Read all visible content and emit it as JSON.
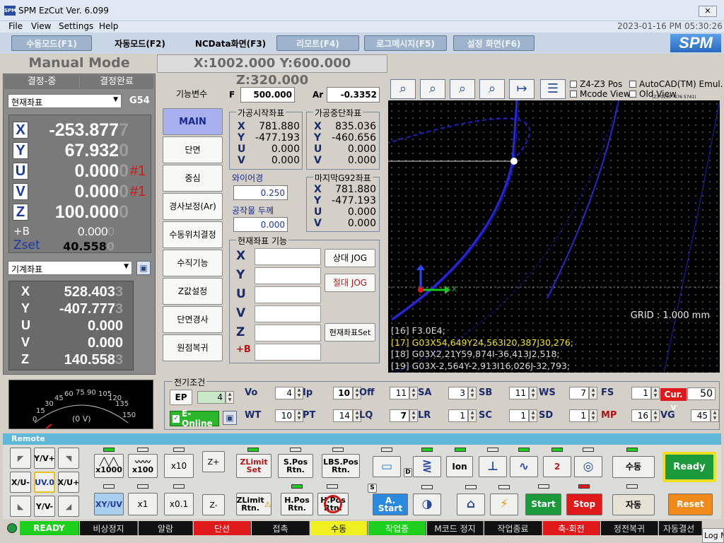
{
  "window": {
    "title": "SPM EzCut Ver. 6.099",
    "app_icon": "SPM",
    "timestamp": "2023-01-16 PM 05:30:26"
  },
  "menu": [
    "File",
    "View",
    "Settings",
    "Help"
  ],
  "tabs": [
    "수동모드(F1)",
    "자동모드(F2)",
    "NCData화면(F3)",
    "리모트(F4)",
    "로그메시지(F5)",
    "설정 화면(F6)"
  ],
  "logo": "SPM",
  "mode_title": "Manual Mode",
  "xyz_readout": "X:1002.000 Y:600.000 Z:320.000",
  "measure": {
    "left": "결정-중",
    "right": "결정완료"
  },
  "coord_select": {
    "value": "현재좌표",
    "work_offset": "G54"
  },
  "current_coords": [
    {
      "axis": "X",
      "value": "-253.877",
      "ghost": "7",
      "suffix": ""
    },
    {
      "axis": "Y",
      "value": "67.932",
      "ghost": "0",
      "suffix": ""
    },
    {
      "axis": "U",
      "value": "0.000",
      "ghost": "0",
      "suffix": "#1"
    },
    {
      "axis": "V",
      "value": "0.000",
      "ghost": "0",
      "suffix": "#1"
    },
    {
      "axis": "Z",
      "value": "100.000",
      "ghost": "0",
      "suffix": ""
    }
  ],
  "plus_b": {
    "label": "+B",
    "value": "0.000",
    "ghost": "0"
  },
  "zset": {
    "label": "Zset",
    "value": "40.558",
    "ghost": "0"
  },
  "machine_select": {
    "value": "기계좌표"
  },
  "machine_coords": [
    {
      "axis": "X",
      "value": "528.403",
      "ghost": "3"
    },
    {
      "axis": "Y",
      "value": "-407.777",
      "ghost": "3"
    },
    {
      "axis": "U",
      "value": "0.000",
      "ghost": ""
    },
    {
      "axis": "V",
      "value": "0.000",
      "ghost": ""
    },
    {
      "axis": "Z",
      "value": "140.558",
      "ghost": "3"
    }
  ],
  "func_label": "기능변수",
  "func_buttons": [
    "MAIN",
    "단면",
    "중심",
    "경사보정(Ar)",
    "수동위치결정",
    "수직기능",
    "Z값설정",
    "단면경사",
    "원점복귀"
  ],
  "f_label": "F",
  "f_value": "500.000",
  "ar_label": "Ar",
  "ar_value": "-0.3352",
  "start_group": {
    "title": "가공시작좌표",
    "rows": [
      {
        "k": "X",
        "v": "781.880"
      },
      {
        "k": "Y",
        "v": "-477.193"
      },
      {
        "k": "U",
        "v": "0.000"
      },
      {
        "k": "V",
        "v": "0.000"
      }
    ]
  },
  "end_group": {
    "title": "가공중단좌표",
    "rows": [
      {
        "k": "X",
        "v": "835.036"
      },
      {
        "k": "Y",
        "v": "-460.656"
      },
      {
        "k": "U",
        "v": "0.000"
      },
      {
        "k": "V",
        "v": "0.000"
      }
    ]
  },
  "g92_group": {
    "title": "마지막G92좌표",
    "rows": [
      {
        "k": "X",
        "v": "781.880"
      },
      {
        "k": "Y",
        "v": "-477.193"
      },
      {
        "k": "U",
        "v": "0.000"
      },
      {
        "k": "V",
        "v": "0.000"
      }
    ]
  },
  "wire_dia": {
    "label": "와이어경",
    "value": "0.250"
  },
  "work_thick": {
    "label": "공작물 두께",
    "value": "0.000"
  },
  "cur_func": {
    "title": "현재좌표 기능",
    "axes": [
      "X",
      "Y",
      "U",
      "V",
      "Z",
      "+B"
    ],
    "rel_jog": "상대 JOG",
    "abs_jog": "절대 JOG",
    "set": "현재좌표Set"
  },
  "toolbar": {
    "z4z3": "Z4-Z3 Pos",
    "mcode": "Mcode View",
    "autocad": "AutoCAD(TM) Emul.",
    "oldview": "Old View",
    "tiny": "(Z3 0230 -476 5741)"
  },
  "canvas": {
    "grid": "GRID : 1.000 mm",
    "lines": [
      {
        "n": "[16]",
        "t": "F3.0E4;",
        "hl": false
      },
      {
        "n": "[17]",
        "t": "G03X54,649Y24,563I20,387J30,276;",
        "hl": true
      },
      {
        "n": "[18]",
        "t": "G03X2,21Y59,874I-36,413J2,518;",
        "hl": false
      },
      {
        "n": "[19]",
        "t": "G03X-2,564Y-2,913I16,026J-32,793;",
        "hl": false
      }
    ]
  },
  "gauge": {
    "ticks": [
      "0",
      "15",
      "30",
      "45",
      "60",
      "75",
      "90",
      "105",
      "120",
      "135",
      "150"
    ],
    "readout": "(0 V)"
  },
  "elec": {
    "title": "전기조건",
    "ep": "EP",
    "ep_val": "4",
    "eonline": "E-Online",
    "curv": "Cur. v",
    "curv_val": "50",
    "row1": [
      {
        "k": "Vo",
        "v": "4"
      },
      {
        "k": "Ip",
        "v": "10"
      },
      {
        "k": "Off",
        "v": "11"
      },
      {
        "k": "SA",
        "v": "3"
      },
      {
        "k": "SB",
        "v": "11"
      },
      {
        "k": "WS",
        "v": "7"
      },
      {
        "k": "FS",
        "v": "1"
      }
    ],
    "row2": [
      {
        "k": "WT",
        "v": "10"
      },
      {
        "k": "PT",
        "v": "14"
      },
      {
        "k": "LQ",
        "v": "7"
      },
      {
        "k": "LR",
        "v": "1"
      },
      {
        "k": "SC",
        "v": "1"
      },
      {
        "k": "SD",
        "v": "1"
      },
      {
        "k": "MP",
        "v": "16"
      },
      {
        "k": "VG",
        "v": "45"
      }
    ]
  },
  "remote": {
    "title": "Remote",
    "y_plus": "Y/V+",
    "x_minus": "X/U-",
    "uv0": "UV.0",
    "x_plus": "X/U+",
    "y_minus": "Y/V-",
    "x1000": "x1000",
    "x100": "x100",
    "x10": "x10",
    "zplus": "Z+",
    "xyuv": "XY/UV",
    "x1": "x1",
    "x01": "x0.1",
    "zminus": "Z-",
    "zlimit_set": "ZLimit Set",
    "spos": "S.Pos Rtn.",
    "lbspos": "LBS.Pos Rtn.",
    "zlimit_rtn": "ZLimit Rtn.",
    "hpos": "H.Pos Rtn.",
    "hpos2": "H.Pos Rtn.",
    "astart": "A. Start",
    "d": "D",
    "s": "S",
    "ion": "Ion",
    "start": "Start",
    "stop": "Stop",
    "sudong": "수동",
    "jadong": "자동",
    "ready": "Ready",
    "reset": "Reset",
    "two": "2"
  },
  "status_bar": [
    "READY",
    "비상정지",
    "알람",
    "단선",
    "접촉",
    "수동",
    "작업중",
    "M코드 정지",
    "작업종료",
    "축-회전",
    "정전복귀",
    "자동결선"
  ],
  "log_tab": "Log M"
}
